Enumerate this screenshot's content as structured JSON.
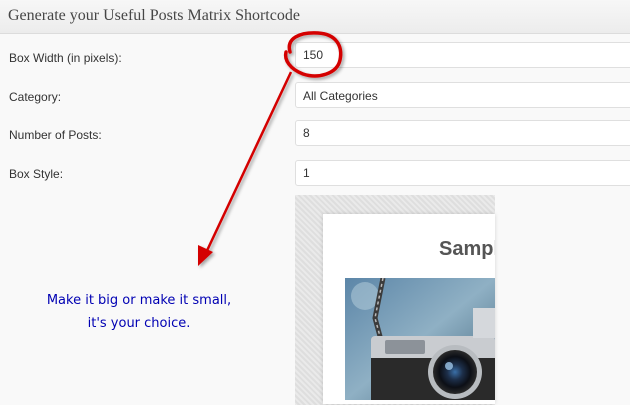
{
  "panel": {
    "title": "Generate your Useful Posts Matrix Shortcode"
  },
  "form": {
    "box_width": {
      "label": "Box Width (in pixels):",
      "value": "150"
    },
    "category": {
      "label": "Category:",
      "value": "All Categories"
    },
    "num_posts": {
      "label": "Number of Posts:",
      "value": "8"
    },
    "box_style": {
      "label": "Box Style:",
      "value": "1"
    }
  },
  "preview": {
    "heading": "Sampl"
  },
  "annotation": {
    "line1": "Make it big or make it small,",
    "line2": "it's your choice.",
    "color": "#0000b3",
    "arrow_color": "#d40000"
  }
}
